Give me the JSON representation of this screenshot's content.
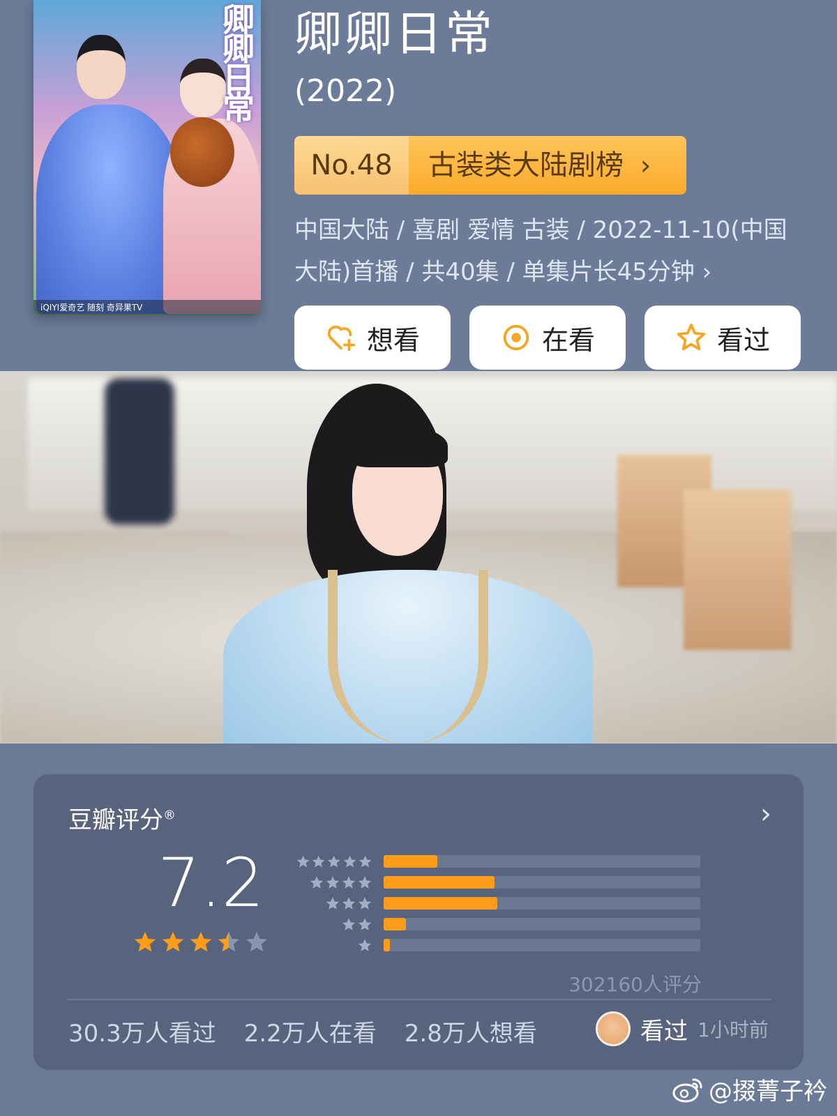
{
  "header": {
    "poster": {
      "title": "卿卿日常",
      "logos": "iQIYI爱奇艺  随刻  奇异果TV"
    },
    "title": "卿卿日常",
    "year": "(2022)",
    "rank": {
      "number": "No.48",
      "list_name": "古装类大陆剧榜"
    },
    "meta_line1": "中国大陆 / 喜剧 爱情 古装 / 2022-11-10(中国",
    "meta_line2": "大陆)首播 / 共40集 / 单集片长45分钟 ›",
    "actions": [
      {
        "label": "想看",
        "icon": "heart-plus-icon"
      },
      {
        "label": "在看",
        "icon": "target-icon"
      },
      {
        "label": "看过",
        "icon": "star-outline-icon"
      }
    ]
  },
  "rating_card": {
    "title": "豆瓣评分",
    "registered_mark": "®",
    "score": "7.2",
    "score_stars": 3.5,
    "distribution": [
      {
        "stars": 5,
        "fraction": 0.17
      },
      {
        "stars": 4,
        "fraction": 0.35
      },
      {
        "stars": 3,
        "fraction": 0.36
      },
      {
        "stars": 2,
        "fraction": 0.07
      },
      {
        "stars": 1,
        "fraction": 0.02
      }
    ],
    "raters": "302160人评分",
    "stats": [
      "30.3万人看过",
      "2.2万人在看",
      "2.8万人想看"
    ],
    "user_status": {
      "label": "看过",
      "time": "1小时前"
    }
  },
  "watermark": "@掇菁子衿",
  "colors": {
    "background": "#6b7a96",
    "card": "#58647e",
    "accent_orange": "#ff9d1a",
    "badge_gold": "#fbab2b"
  }
}
